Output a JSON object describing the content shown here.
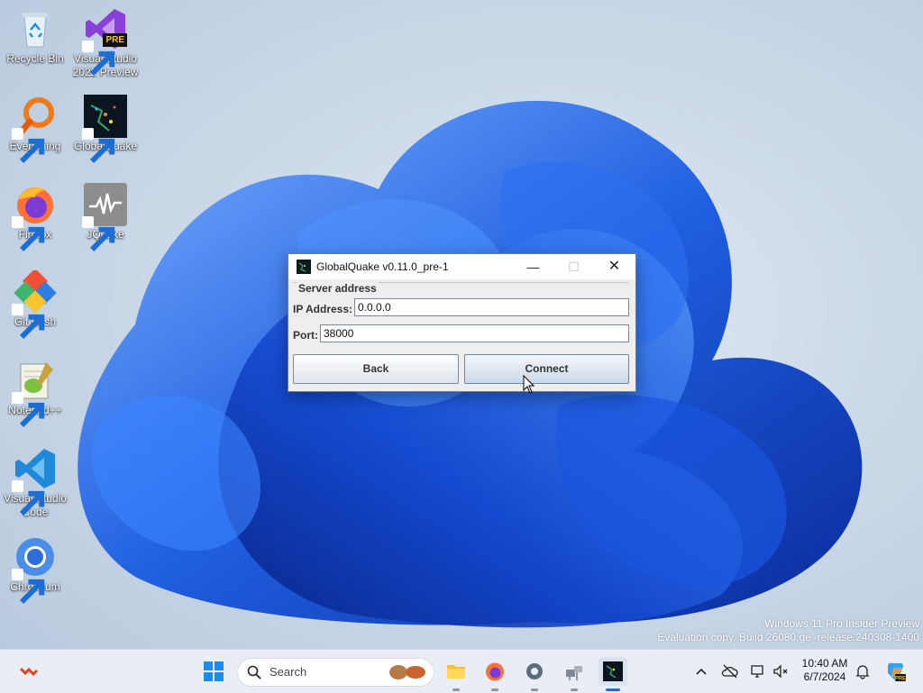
{
  "desktop": {
    "icons": [
      {
        "label": "Recycle Bin",
        "icon": "recycle-bin-icon"
      },
      {
        "label": "Visual Studio 2022 Preview",
        "icon": "visual-studio-icon",
        "badge": "PRE"
      },
      {
        "label": "Everything",
        "icon": "everything-search-icon"
      },
      {
        "label": "GlobalQuake",
        "icon": "globalquake-icon"
      },
      {
        "label": "Firefox",
        "icon": "firefox-icon"
      },
      {
        "label": "JQuake",
        "icon": "jquake-icon"
      },
      {
        "label": "Git Bash",
        "icon": "git-bash-icon"
      },
      {
        "label": "Notepad++",
        "icon": "notepadpp-icon"
      },
      {
        "label": "Visual Studio Code",
        "icon": "vscode-icon"
      },
      {
        "label": "Chromium",
        "icon": "chromium-icon"
      }
    ]
  },
  "dialog": {
    "title": "GlobalQuake v0.11.0_pre-1",
    "controls": {
      "minimize": "—",
      "maximize": "☐",
      "close": "✕"
    },
    "group_label": "Server address",
    "ip_label": "IP Address:",
    "ip_value": "0.0.0.0",
    "port_label": "Port:",
    "port_value": "38000",
    "back_label": "Back",
    "connect_label": "Connect"
  },
  "watermark": {
    "line1": "Windows 11 Pro Insider Preview",
    "line2": "Evaluation copy. Build 26080.ge_release.240308-1400"
  },
  "taskbar": {
    "search_placeholder": "Search",
    "apps": [
      "start-icon",
      "file-explorer-icon",
      "firefox-icon",
      "settings-icon",
      "network-app-icon",
      "globalquake-icon"
    ],
    "clock_time": "10:40 AM",
    "clock_date": "6/7/2024"
  },
  "colors": {
    "accent": "#1c6ed3",
    "wallpaper_blue": "#1f5fe0",
    "taskbar": "#e9eef5",
    "dialog_bg": "#eeeeee"
  }
}
